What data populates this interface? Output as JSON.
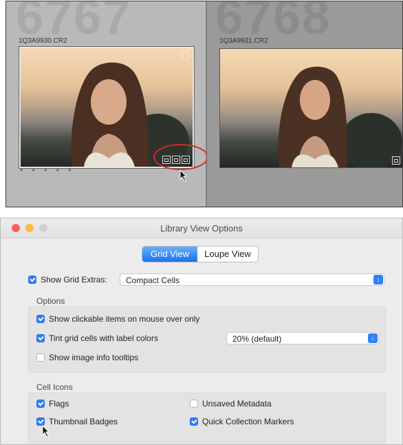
{
  "grid": {
    "cells": [
      {
        "number": "6767",
        "filename": "1Q3A9930.CR2"
      },
      {
        "number": "6768",
        "filename": "1Q3A9931.CR2"
      }
    ],
    "rating_dots": "• • • • •",
    "highlight_color": "#d52a2a"
  },
  "dialog": {
    "title": "Library View Options",
    "tabs": [
      {
        "label": "Grid View",
        "active": true
      },
      {
        "label": "Loupe View",
        "active": false
      }
    ],
    "show_grid_extras": {
      "label": "Show Grid Extras:",
      "checked": true,
      "value": "Compact Cells"
    },
    "options": {
      "heading": "Options",
      "items": [
        {
          "label": "Show clickable items on mouse over only",
          "checked": true
        },
        {
          "label": "Tint grid cells with label colors",
          "checked": true,
          "select_value": "20% (default)"
        },
        {
          "label": "Show image info tooltips",
          "checked": false
        }
      ]
    },
    "cell_icons": {
      "heading": "Cell Icons",
      "items": [
        {
          "label": "Flags",
          "checked": true
        },
        {
          "label": "Unsaved Metadata",
          "checked": false
        },
        {
          "label": "Thumbnail Badges",
          "checked": true
        },
        {
          "label": "Quick Collection Markers",
          "checked": true
        }
      ]
    },
    "accent_color": "#2f7ff5"
  }
}
